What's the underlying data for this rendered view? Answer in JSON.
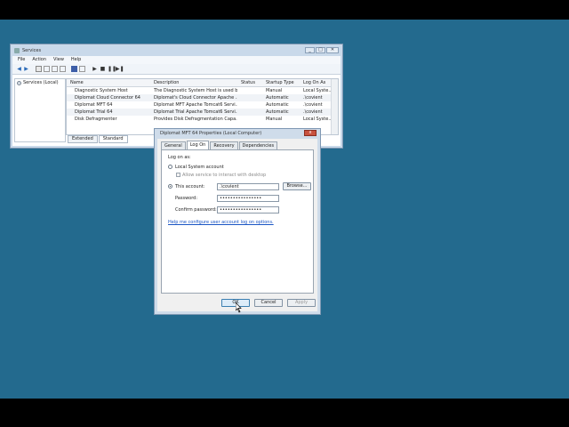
{
  "services_window": {
    "title": "Services",
    "menu": [
      "File",
      "Action",
      "View",
      "Help"
    ],
    "tree_item": "Services (Local)",
    "columns": [
      "Name",
      "Description",
      "Status",
      "Startup Type",
      "Log On As"
    ],
    "rows": [
      {
        "name": "Diagnostic System Host",
        "description": "The Diagnostic System Host is used b...",
        "status": "",
        "startup": "Manual",
        "logon": "Local Syste..."
      },
      {
        "name": "Diplomat Cloud Connector 64",
        "description": "Diplomat's Cloud Connector Apache ...",
        "status": "",
        "startup": "Automatic",
        "logon": ".\\covient"
      },
      {
        "name": "Diplomat MFT 64",
        "description": "Diplomat MFT Apache Tomcat6 Servi...",
        "status": "",
        "startup": "Automatic",
        "logon": ".\\covient"
      },
      {
        "name": "Diplomat Trial 64",
        "description": "Diplomat Trial Apache Tomcat6 Servi...",
        "status": "",
        "startup": "Automatic",
        "logon": ".\\covient"
      },
      {
        "name": "Disk Defragmenter",
        "description": "Provides Disk Defragmentation Capa...",
        "status": "",
        "startup": "Manual",
        "logon": "Local Syste..."
      }
    ],
    "tabs": [
      "Extended",
      "Standard"
    ],
    "active_tab": "Standard"
  },
  "dialog": {
    "title": "Diplomat MFT 64 Properties (Local Computer)",
    "close_label": "x",
    "tabs": [
      "General",
      "Log On",
      "Recovery",
      "Dependencies"
    ],
    "active_tab": "Log On",
    "group_label": "Log on as:",
    "local_system_label": "Local System account",
    "allow_desktop_label": "Allow service to interact with desktop",
    "this_account_label": "This account:",
    "account_value": ".\\covient",
    "browse_label": "Browse...",
    "password_label": "Password:",
    "password_value": "••••••••••••••••",
    "confirm_label": "Confirm password:",
    "confirm_value": "••••••••••••••••",
    "help_link": "Help me configure user account log on options.",
    "ok_label": "OK",
    "cancel_label": "Cancel",
    "apply_label": "Apply"
  },
  "colors": {
    "desktop": "#236a8e",
    "window_frame": "#c9d9ea",
    "link": "#1a55c4"
  }
}
